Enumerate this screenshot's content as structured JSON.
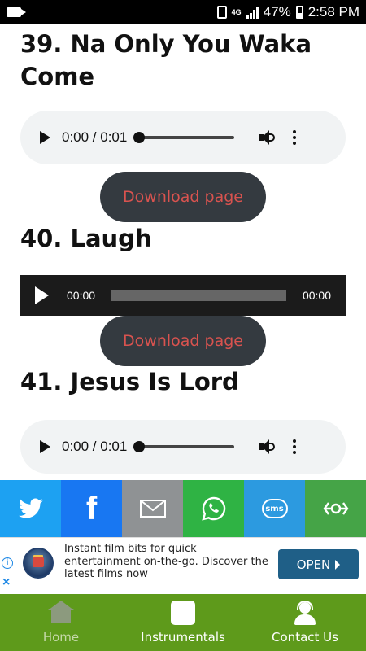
{
  "status_bar": {
    "battery": "47%",
    "time": "2:58 PM",
    "network": "4G"
  },
  "songs": [
    {
      "title": "39. Na Only You Waka Come",
      "player": {
        "time": "0:00 / 0:01"
      },
      "download_label": "Download page"
    },
    {
      "title": "40. Laugh",
      "player": {
        "current": "00:00",
        "duration": "00:00"
      },
      "download_label": "Download page"
    },
    {
      "title": "41. Jesus Is Lord",
      "player": {
        "time": "0:00 / 0:01"
      }
    }
  ],
  "share_bar": {
    "buttons": [
      {
        "name": "twitter",
        "icon": "twitter-bird-icon",
        "color": "#1da1f2"
      },
      {
        "name": "facebook",
        "icon": "facebook-f-icon",
        "label": "f",
        "color": "#1877f2"
      },
      {
        "name": "email",
        "icon": "envelope-icon",
        "color": "#8f9294"
      },
      {
        "name": "whatsapp",
        "icon": "whatsapp-icon",
        "color": "#2fb344"
      },
      {
        "name": "sms",
        "icon": "sms-bubble-icon",
        "label": "sms",
        "color": "#2c9ae0"
      },
      {
        "name": "sharethis",
        "icon": "share-icon",
        "color": "#45a447"
      }
    ]
  },
  "ad": {
    "text": "Instant film bits for quick entertainment on-the-go. Discover the latest films now",
    "cta": "OPEN",
    "info_glyph": "i",
    "close_glyph": "×"
  },
  "bottom_nav": {
    "background": "#5e9a1b",
    "items": [
      {
        "label": "Home",
        "icon": "home-icon"
      },
      {
        "label": "Instrumentals",
        "icon": "instrumentals-icon"
      },
      {
        "label": "Contact Us",
        "icon": "headset-contact-icon"
      }
    ]
  },
  "colors": {
    "download_button_bg": "#343a40",
    "download_button_text": "#d9534f",
    "ad_cta": "#1f5f87"
  }
}
